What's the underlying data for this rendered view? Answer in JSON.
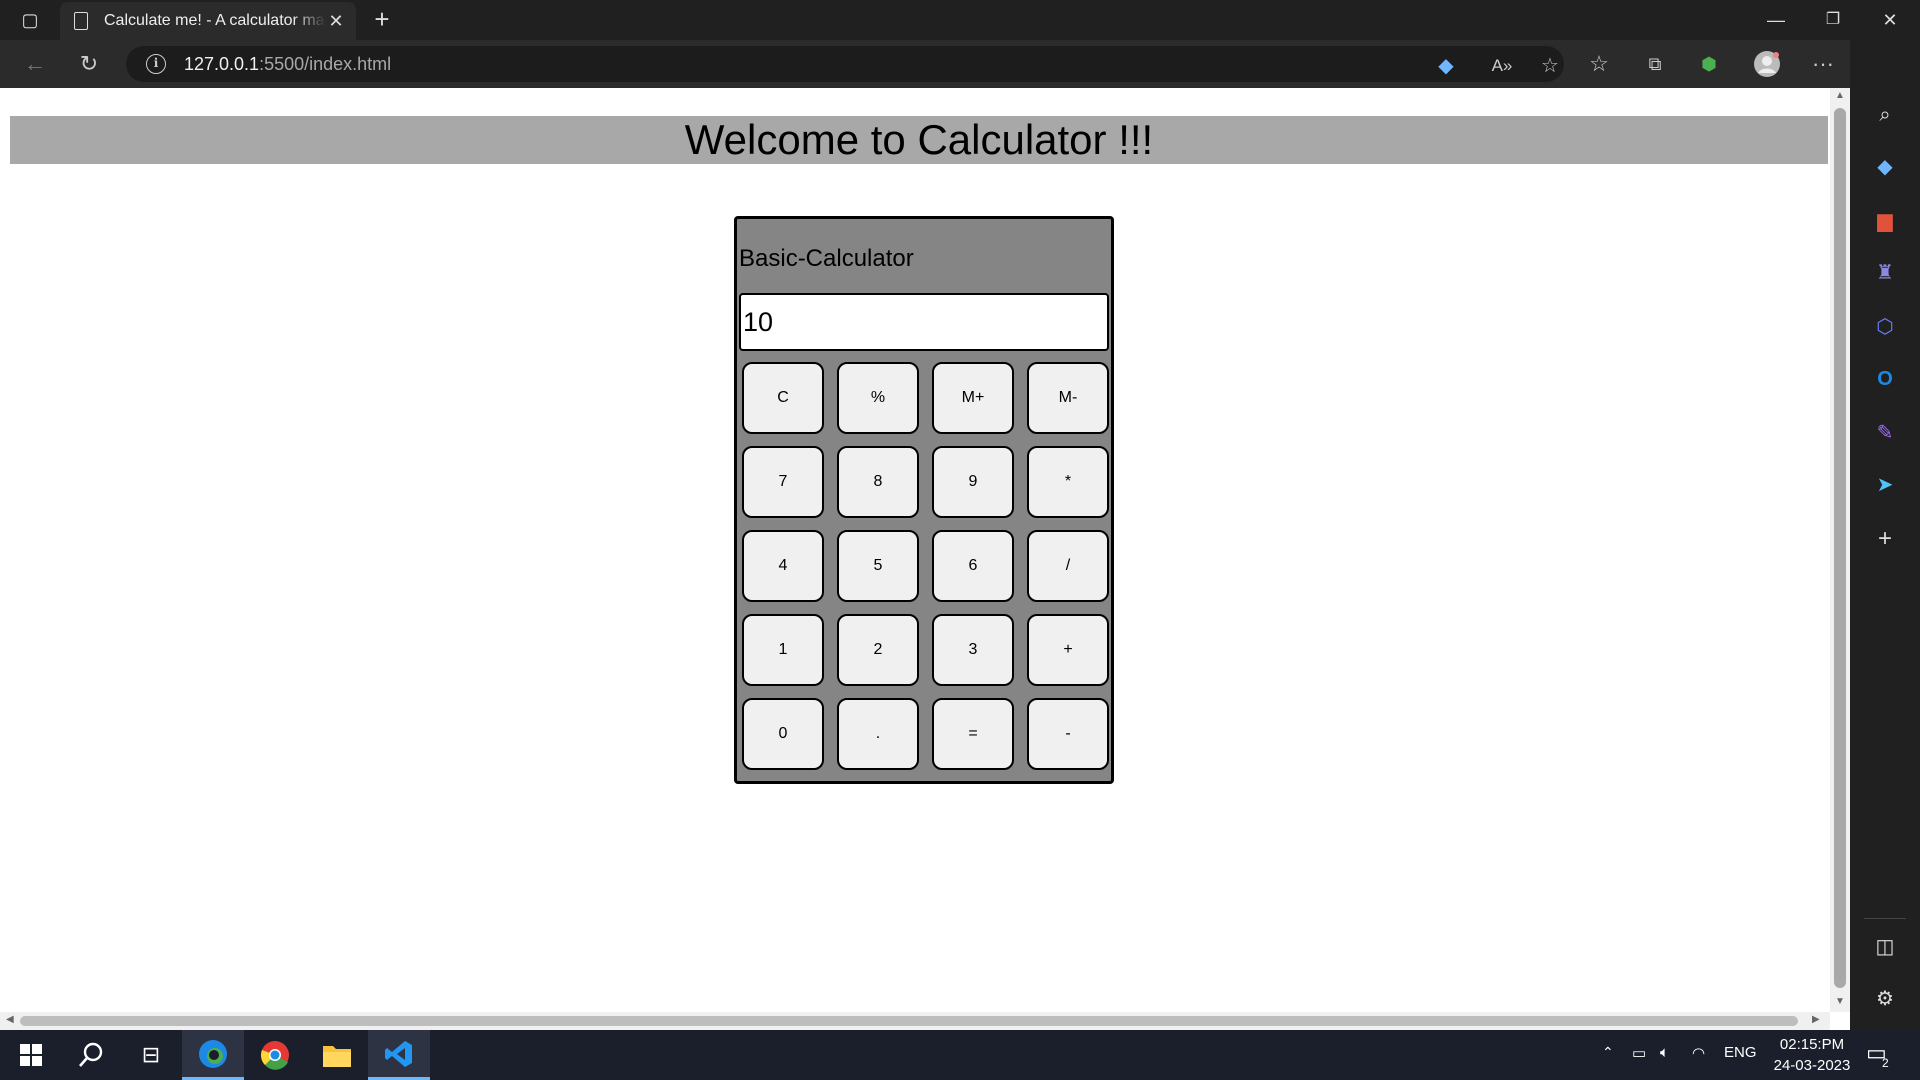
{
  "browser": {
    "tab_title": "Calculate me! - A calculator made",
    "url_host": "127.0.0.1",
    "url_path": ":5500/index.html"
  },
  "page": {
    "heading": "Welcome to Calculator !!!"
  },
  "calculator": {
    "name": "Basic-Calculator",
    "display_value": "10",
    "keys": [
      {
        "label": "C",
        "name": "key-clear"
      },
      {
        "label": "%",
        "name": "key-percent"
      },
      {
        "label": "M+",
        "name": "key-memory-plus"
      },
      {
        "label": "M-",
        "name": "key-memory-minus"
      },
      {
        "label": "7",
        "name": "key-7"
      },
      {
        "label": "8",
        "name": "key-8"
      },
      {
        "label": "9",
        "name": "key-9"
      },
      {
        "label": "*",
        "name": "key-multiply"
      },
      {
        "label": "4",
        "name": "key-4"
      },
      {
        "label": "5",
        "name": "key-5"
      },
      {
        "label": "6",
        "name": "key-6"
      },
      {
        "label": "/",
        "name": "key-divide"
      },
      {
        "label": "1",
        "name": "key-1"
      },
      {
        "label": "2",
        "name": "key-2"
      },
      {
        "label": "3",
        "name": "key-3"
      },
      {
        "label": "+",
        "name": "key-add"
      },
      {
        "label": "0",
        "name": "key-0"
      },
      {
        "label": ".",
        "name": "key-decimal"
      },
      {
        "label": "=",
        "name": "key-equals"
      },
      {
        "label": "-",
        "name": "key-subtract"
      }
    ]
  },
  "taskbar": {
    "language": "ENG",
    "time": "02:15:PM",
    "date": "24-03-2023",
    "notification_count": "2"
  },
  "colors": {
    "page_heading_bg": "#a8a8a8",
    "calculator_bg": "#858585",
    "key_bg": "#f0f0f0"
  }
}
